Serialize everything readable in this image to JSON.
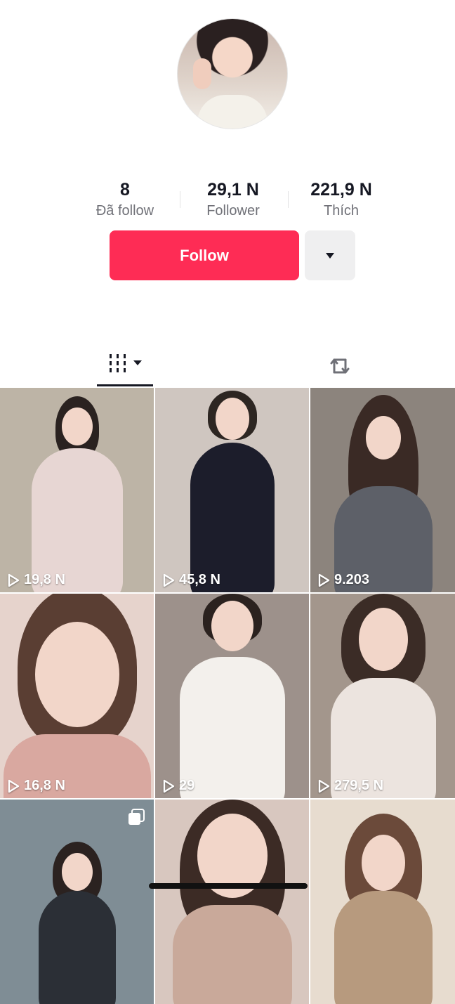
{
  "profile": {
    "stats": [
      {
        "value": "8",
        "label": "Đã follow"
      },
      {
        "value": "29,1 N",
        "label": "Follower"
      },
      {
        "value": "221,9 N",
        "label": "Thích"
      }
    ],
    "follow_label": "Follow"
  },
  "tabs": {
    "videos_icon": "grid-lines-icon",
    "reposts_icon": "repost-icon"
  },
  "videos": [
    {
      "views": "19,8 N",
      "bg": "#bdb4a6",
      "outfit": "#e7d6d3"
    },
    {
      "views": "45,8 N",
      "bg": "#cfc6c0",
      "outfit": "#1c1d2b"
    },
    {
      "views": "9.203",
      "bg": "#8c847d",
      "outfit": "#5d6068"
    },
    {
      "views": "16,8 N",
      "bg": "#e6d3cc",
      "outfit": "#d9a8a0"
    },
    {
      "views": "29",
      "bg": "#9d918b",
      "outfit": "#f3f0ec"
    },
    {
      "views": "279,5 N",
      "bg": "#a3968c",
      "outfit": "#ece4df"
    },
    {
      "views": "",
      "bg": "#7f8d95",
      "outfit": "#2b2f36"
    },
    {
      "views": "",
      "bg": "#d8c7bf",
      "outfit": "#c9a99a"
    },
    {
      "views": "",
      "bg": "#e7dccf",
      "outfit": "#b79a7e"
    }
  ],
  "colors": {
    "accent": "#fe2c55",
    "text": "#161823",
    "secondary_text": "#6f7077"
  }
}
